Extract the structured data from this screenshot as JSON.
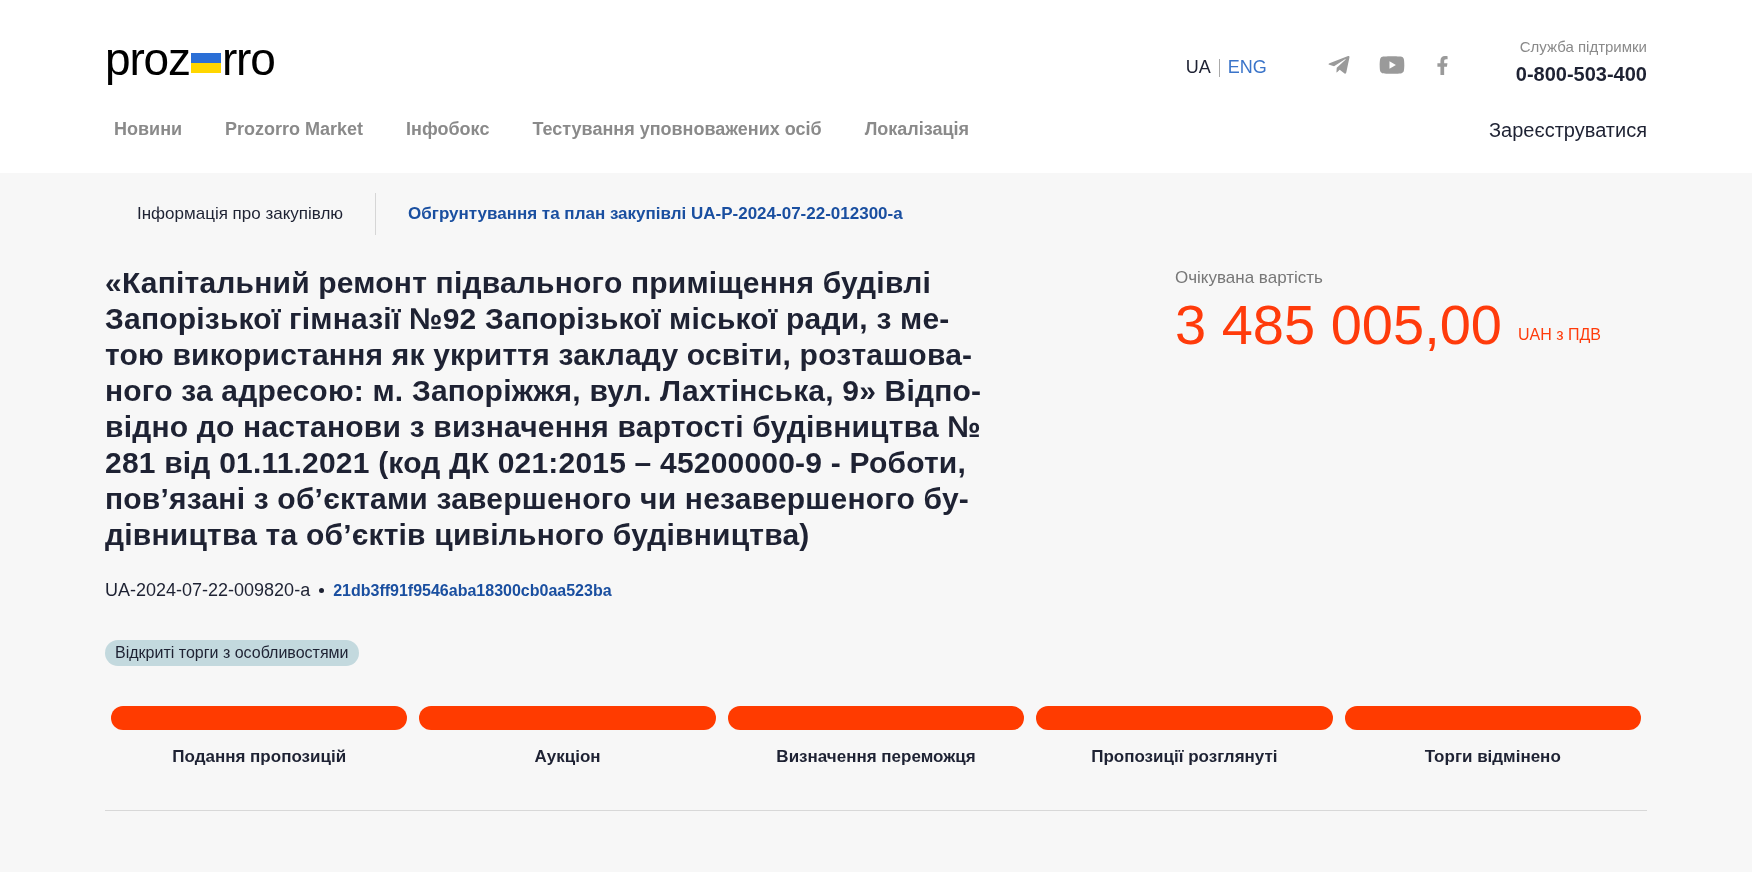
{
  "header": {
    "logo": {
      "before": "proz",
      "after": "rro"
    },
    "languages": [
      {
        "label": "UA",
        "selected": true
      },
      {
        "label": "ENG",
        "selected": false
      }
    ],
    "support": {
      "label": "Служба підтримки",
      "phone": "0-800-503-400"
    },
    "nav": [
      "Новини",
      "Prozorro Market",
      "Інфобокс",
      "Тестування уповноважених осіб",
      "Локалізація"
    ],
    "register": "Зареєструватися"
  },
  "tabs": [
    {
      "label": "Інформація про закупівлю",
      "selected": true
    },
    {
      "label": "Обгрунтування та план закупівлі UA-P-2024-07-22-012300-a",
      "selected": false
    }
  ],
  "tender": {
    "title_lines": [
      "«Капітальний ремонт підвального приміщення будівлі",
      "Запорізької гімназії №92 Запорізької міської ради, з ме-",
      "тою використання як укриття закладу освіти, розташова-",
      "ного за адресою: м. Запоріжжя, вул. Лахтінська, 9» Відпо-",
      "відно до настанови з визначення вартості будівництва №",
      "281 від 01.11.2021 (код ДК 021:2015 – 45200000-9 - Роботи,",
      "пов’язані з об’єктами завершеного чи незавершеного бу-",
      "дівництва та об’єктів цивільного будівництва)"
    ],
    "id": "UA-2024-07-22-009820-a",
    "hash": "21db3ff91f9546aba18300cb0aa523ba",
    "procedure": "Відкриті торги з особливостями",
    "value_label": "Очікувана вартість",
    "value": "3 485 005,00",
    "currency": "UAH з ПДВ"
  },
  "stages": [
    "Подання пропозицій",
    "Аукціон",
    "Визначення переможця",
    "Пропозиції розглянуті",
    "Торги відмінено"
  ]
}
